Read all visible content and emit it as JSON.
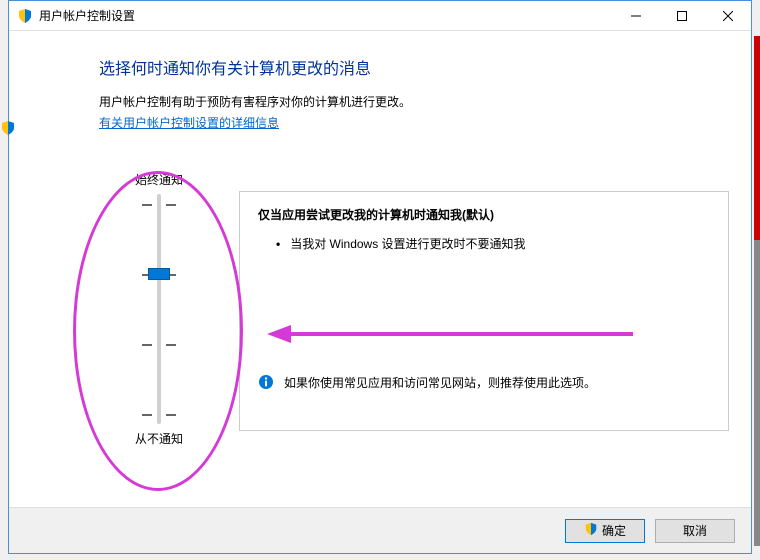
{
  "titlebar": {
    "title": "用户帐户控制设置"
  },
  "heading": "选择何时通知你有关计算机更改的消息",
  "subtext": "用户帐户控制有助于预防有害程序对你的计算机进行更改。",
  "link": "有关用户帐户控制设置的详细信息",
  "slider": {
    "top_label": "始终通知",
    "bottom_label": "从不通知",
    "levels": 4,
    "current_level_from_top": 1
  },
  "panel": {
    "title": "仅当应用尝试更改我的计算机时通知我(默认)",
    "bullets": [
      "当我对 Windows 设置进行更改时不要通知我"
    ],
    "note": "如果你使用常见应用和访问常见网站，则推荐使用此选项。"
  },
  "buttons": {
    "ok": "确定",
    "cancel": "取消"
  },
  "icons": {
    "shield": "shield-icon",
    "info": "info-icon"
  }
}
